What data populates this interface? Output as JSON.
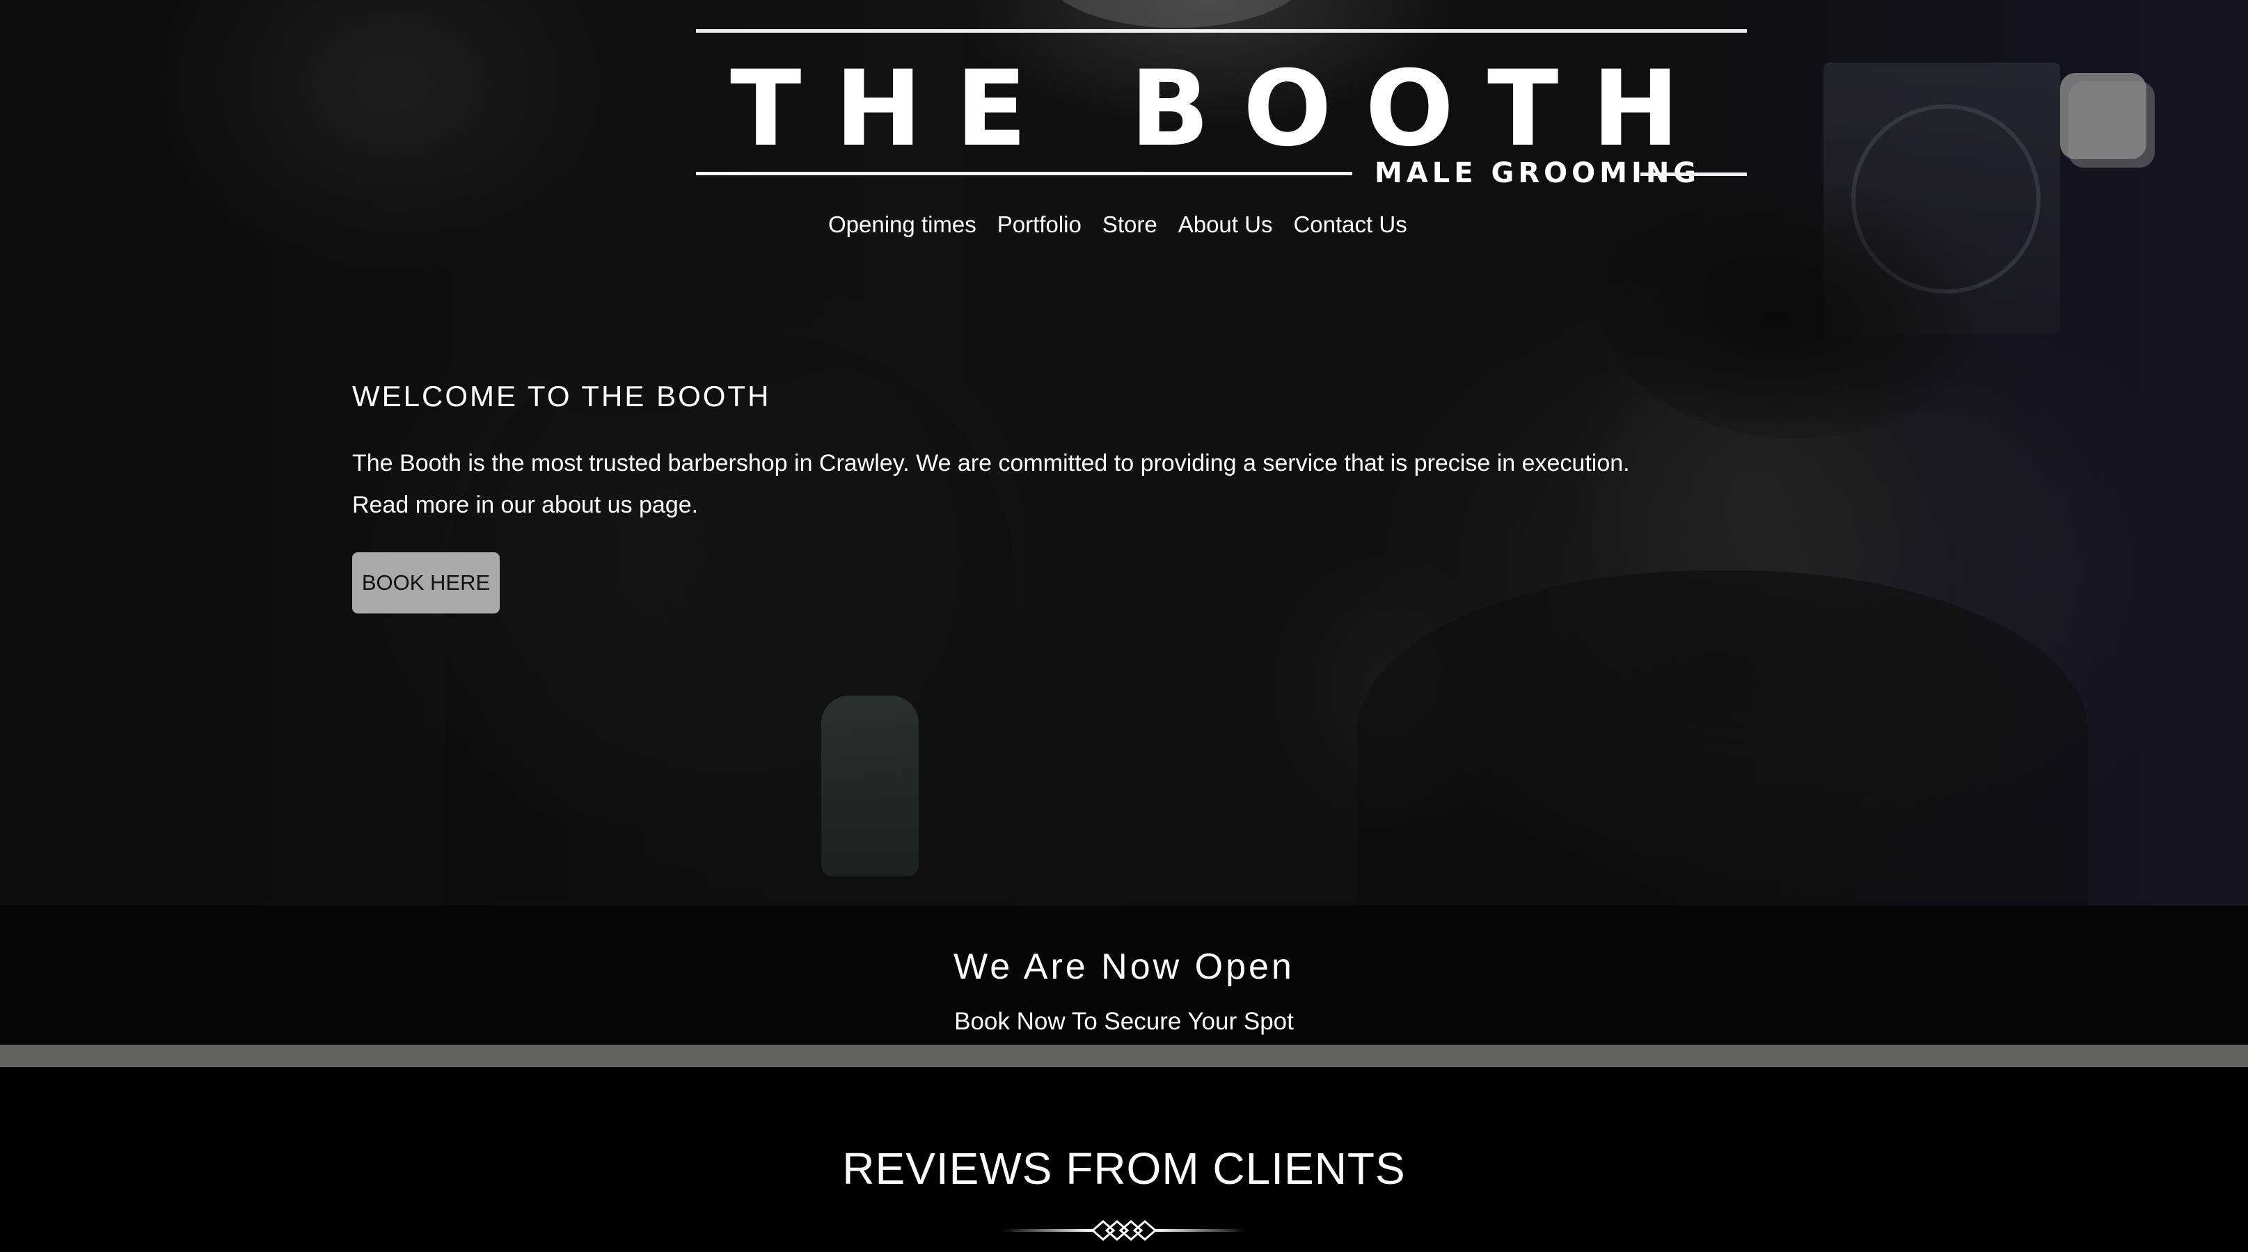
{
  "brand": {
    "wordmark": "THE BOOTH",
    "tagline": "MALE GROOMING"
  },
  "nav": {
    "items": [
      "Opening times",
      "Portfolio",
      "Store",
      "About Us",
      "Contact Us"
    ]
  },
  "hero": {
    "heading": "WELCOME TO THE BOOTH",
    "body_line1": "The Booth is the most trusted barbershop in Crawley. We are committed to providing a service that is precise in execution.",
    "body_line2": "Read more in our about us page.",
    "cta_label": "BOOK HERE"
  },
  "banner": {
    "title": "We Are Now Open",
    "subtitle": "Book Now To Secure Your Spot"
  },
  "reviews": {
    "title": "REVIEWS FROM CLIENTS"
  },
  "colors": {
    "background": "#000000",
    "text": "#ffffff",
    "button_bg": "#a9a9a9",
    "divider_bar": "#62645e"
  }
}
